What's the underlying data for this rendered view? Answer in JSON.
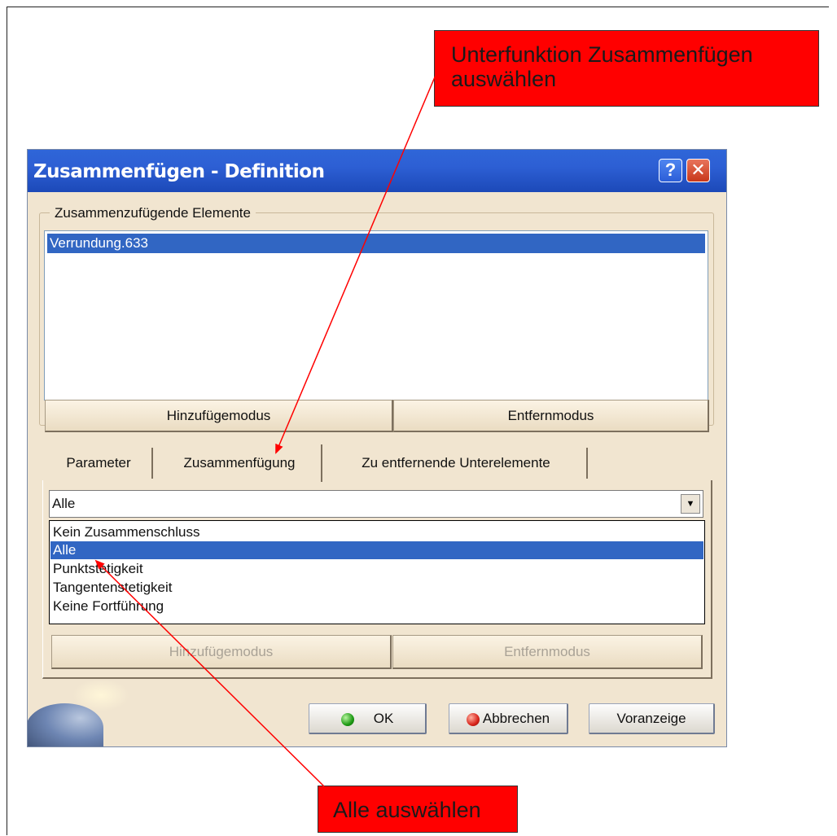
{
  "annotations": {
    "top_callout": "Unterfunktion Zusammenfügen auswählen",
    "bottom_callout": "Alle auswählen",
    "callout_color": "#ff0000",
    "arrow_color": "#ff0000"
  },
  "dialog": {
    "title": "Zusammenfügen - Definition",
    "help_label": "?",
    "close_label": "✕",
    "titlebar_color": "#2d5fd4",
    "background_color": "#f1e5d0",
    "elements_group": {
      "label": "Zusammenzufügende Elemente",
      "items": [
        "Verrundung.633"
      ],
      "selected_index": 0,
      "add_mode_label": "Hinzufügemodus",
      "remove_mode_label": "Entfernmodus"
    },
    "tabs": [
      {
        "label": "Parameter",
        "active": false
      },
      {
        "label": "Zusammenfügung",
        "active": true
      },
      {
        "label": "Zu entfernende Unterelemente",
        "active": false
      }
    ],
    "merge_combo": {
      "value": "Alle",
      "options": [
        "Kein Zusammenschluss",
        "Alle",
        "Punktstetigkeit",
        "Tangentenstetigkeit",
        "Keine Fortführung"
      ],
      "highlighted_index": 1
    },
    "disabled_buttons": {
      "add_mode_label": "Hinzufügemodus",
      "remove_mode_label": "Entfernmodus"
    },
    "footer": {
      "ok_label": "OK",
      "cancel_label": "Abbrechen",
      "preview_label": "Voranzeige",
      "ok_icon": "green-ball-icon",
      "cancel_icon": "red-ball-icon"
    },
    "selection_color": "#3166c3"
  }
}
